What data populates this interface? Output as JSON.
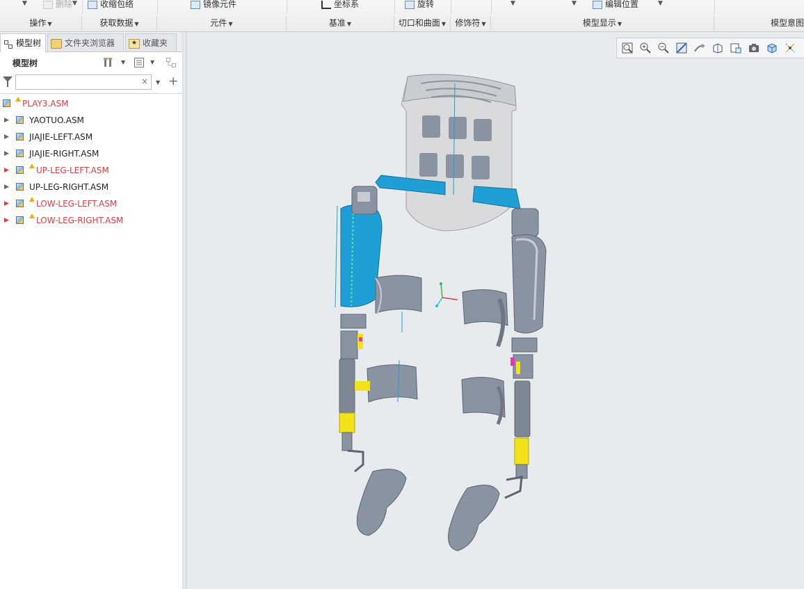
{
  "ribbon": {
    "top_items": [
      {
        "label": "删除",
        "disabled": true
      },
      {
        "label": "收缩包络"
      },
      {
        "label": "镜像元件"
      },
      {
        "label": "坐标系"
      },
      {
        "label": "旋转"
      },
      {
        "label": "编辑位置"
      }
    ],
    "groups": [
      {
        "label": "操作"
      },
      {
        "label": "获取数据"
      },
      {
        "label": "元件"
      },
      {
        "label": "基准"
      },
      {
        "label": "切口和曲面"
      },
      {
        "label": "修饰符"
      },
      {
        "label": "模型显示"
      },
      {
        "label": "模型意图"
      }
    ]
  },
  "left_panel": {
    "tabs": [
      {
        "label": "模型树",
        "active": true,
        "icon": "model-tree-icon"
      },
      {
        "label": "文件夹浏览器",
        "icon": "folder-icon"
      },
      {
        "label": "收藏夹",
        "icon": "favorites-icon"
      }
    ],
    "tree_title": "模型树",
    "search": {
      "value": "",
      "placeholder": ""
    },
    "clear_symbol": "×",
    "add_symbol": "+",
    "items": [
      {
        "label": "PLAY3.ASM",
        "warning": true,
        "root": true
      },
      {
        "label": "YAOTUO.ASM",
        "warning": false
      },
      {
        "label": "JIAJIE-LEFT.ASM",
        "warning": false
      },
      {
        "label": "JIAJIE-RIGHT.ASM",
        "warning": false
      },
      {
        "label": "UP-LEG-LEFT.ASM",
        "warning": true
      },
      {
        "label": "UP-LEG-RIGHT.ASM",
        "warning": false
      },
      {
        "label": "LOW-LEG-LEFT.ASM",
        "warning": true
      },
      {
        "label": "LOW-LEG-RIGHT.ASM",
        "warning": true
      }
    ]
  },
  "view_toolbar": {
    "buttons": [
      "refit-icon",
      "zoom-in-icon",
      "zoom-out-icon",
      "repaint-icon",
      "spin-center-icon",
      "named-views-icon",
      "saved-orientations-icon",
      "view-manager-icon",
      "display-style-icon",
      "datum-display-icon"
    ]
  },
  "colors": {
    "viewport_bg": "#e8ebee",
    "part_gray": "#8a93a1",
    "part_blue": "#1f9fd6",
    "part_yellow": "#f2e21a",
    "warning_red": "#e03c3c"
  }
}
